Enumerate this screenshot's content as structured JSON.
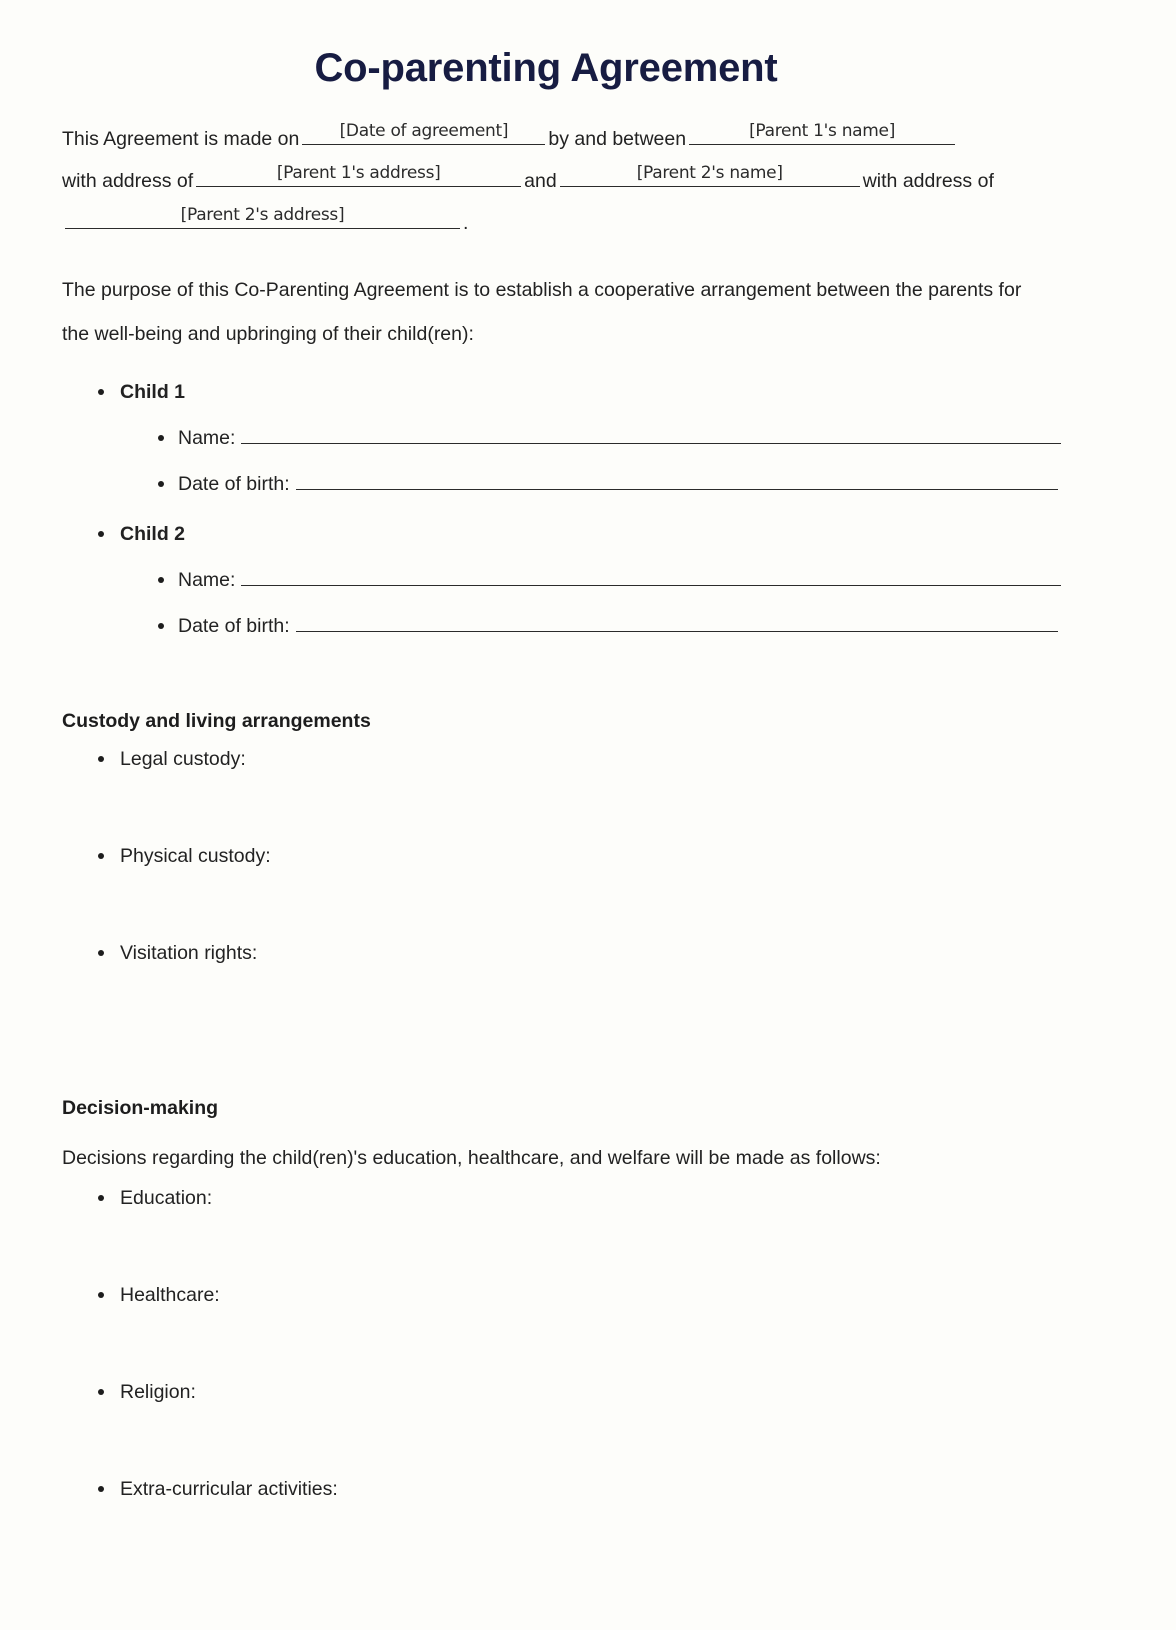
{
  "document": {
    "title": "Co-parenting Agreement",
    "title_color": "#171c42",
    "page_background": "#fdfdfa",
    "text_color": "#222222"
  },
  "intro": {
    "lead": "This Agreement is made on",
    "date_placeholder": "[Date of agreement]",
    "between": "by and between",
    "parent1_name_placeholder": "[Parent 1's name]",
    "with_address_of": "with address of",
    "parent1_address_placeholder": "[Parent 1's address]",
    "and": "and",
    "parent2_name_placeholder": "[Parent 2's name]",
    "with": "with",
    "address_of": "address of",
    "parent2_address_placeholder": "[Parent 2's address]",
    "period": "."
  },
  "purpose": {
    "paragraph": "The purpose of this Co-Parenting Agreement is to establish a cooperative arrangement between the parents for the well-being and upbringing of their child(ren):"
  },
  "children": [
    {
      "heading": "Child 1",
      "name_label": "Name:",
      "dob_label": "Date of birth:"
    },
    {
      "heading": "Child 2",
      "name_label": "Name:",
      "dob_label": "Date of birth:"
    }
  ],
  "custody_section": {
    "heading": "Custody and living arrangements",
    "items": [
      "Legal custody:",
      "Physical custody:",
      "Visitation rights:"
    ]
  },
  "decision_section": {
    "heading": "Decision-making",
    "paragraph": "Decisions regarding the child(ren)'s education, healthcare, and welfare will be made as follows:",
    "items": [
      "Education:",
      "Healthcare:",
      "Religion:",
      "Extra-curricular activities:"
    ]
  }
}
